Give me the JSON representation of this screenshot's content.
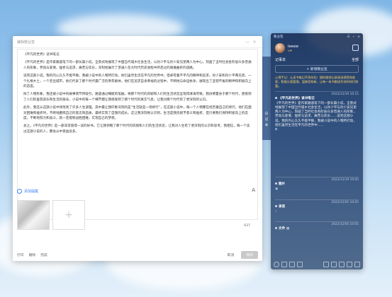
{
  "editor": {
    "title": "编辑敬业签",
    "min_label": "—",
    "close_label": "×",
    "paragraphs": [
      "《平凡的世界》读书笔记",
      "《平凡的世界》是作家路遥笔下的一部长篇小说，全景式地展现了中国当代城乡社会生活，以孙少平与孙少安兄弟两人为中心，刻画了当时社会各阶层众多普通人的形象，劳动与爱情、挫折与追求、痛苦与欢乐，深刻地展示了普通人在大时代历史进程中所走过的艰难曲折的道路。",
      "读完这部小说，我的内心久久不能平静。我被小说中的人物所打动，他们虽然生活在平凡的世界中，但却有着不平凡的精神和追求。孙少安和孙少平两兄弟，一个扎根乡土，一个走出城市，他们代表了那个时代最广泛的青年群体。他们在追求自身幸福的过程中，不断地与命运抗争，展现出了坚韧不拔的精神和积极向上的态度。",
      "除了人物形象，我还被小说中的故事情节所吸引。路遥通过细腻的笔触，将那个时代的风貌和人们的生活状态呈现得淋漓尽致。我仿佛置身于那个时代，感受到了人们的喜怒哀乐和生活的艰辛。小说中的每一个细节都让我感受到了那个时代的真实气息，让我对那个时代有了更深刻的认识。",
      "此外，我还从这部小说中领悟到了许多人生道理。其中最让我印象深刻的是“生活就是一场修行”，在这部小说中，每一个人物都在经历着自己的修行。他们在面对困难和挫折时，不断地磨练自己的意志和品质，最终实现了自我的成长。这让我深刻地认识到，生活是我先赋予意义和挫折，但只要我们保持积极向上的态度，不断地努力和奋斗，就一定能够战胜困难，实现自己的梦想。",
      "总之，《平凡的世界》是一部非常值得一读的好书。它让我领略了那个时代的风貌和人们的生活状态，让我对人生有了更深刻的认识和思考。我相信，每一个读过这部小说的人，都会从中受益良多。"
    ],
    "char_count": "637",
    "add_tag_label": "添加提醒",
    "font_icon_label": "A",
    "bottom_links": [
      "打印",
      "删除",
      "完成"
    ],
    "cancel_label": "取消",
    "save_label": "保存"
  },
  "side_tab": [
    "日",
    "记",
    "本"
  ],
  "note_widget": {
    "app_title": "敬业签",
    "top_icons": [
      "☰",
      "─",
      "×"
    ],
    "username": "leeee",
    "vip_label": "VIP",
    "section_label": "记事本",
    "filter_label": "全部",
    "new_note_label": "+ 新增敬业签",
    "hint_text": "心得手记：让读书笔记不再杂乱！随时随地记录阅读感受和收获，智能分类管理，温故而知新，让每一本书都成为你的知识财富。",
    "items": [
      {
        "date": "2023/12/19 10:15",
        "title": "《平凡的世界》读书笔记",
        "body": "《平凡的世界》是作家路遥笔下的一部长篇小说，全景式地展现了中国当代城乡社会生活，以孙少平与孙少安兄弟两人为中心，刻画了当时社会各阶层众多普通人的形象，劳动与爱情、挫折与追求、痛苦与欢乐……读完这部小说，我的内心久久不能平静，我被小说中的人物所打动，他们虽然生活在平凡的世界中……",
        "icons": "⧉"
      },
      {
        "date": "2023/12/19 10:05",
        "title": "图片",
        "body": "",
        "icons": "▣"
      },
      {
        "date": "2023/12/05 10:05",
        "title": "录音",
        "body": "",
        "icons": "♪"
      },
      {
        "date": "2023/12/05 10:05",
        "title": "文件",
        "body": "",
        "icons": "▤"
      }
    ]
  }
}
